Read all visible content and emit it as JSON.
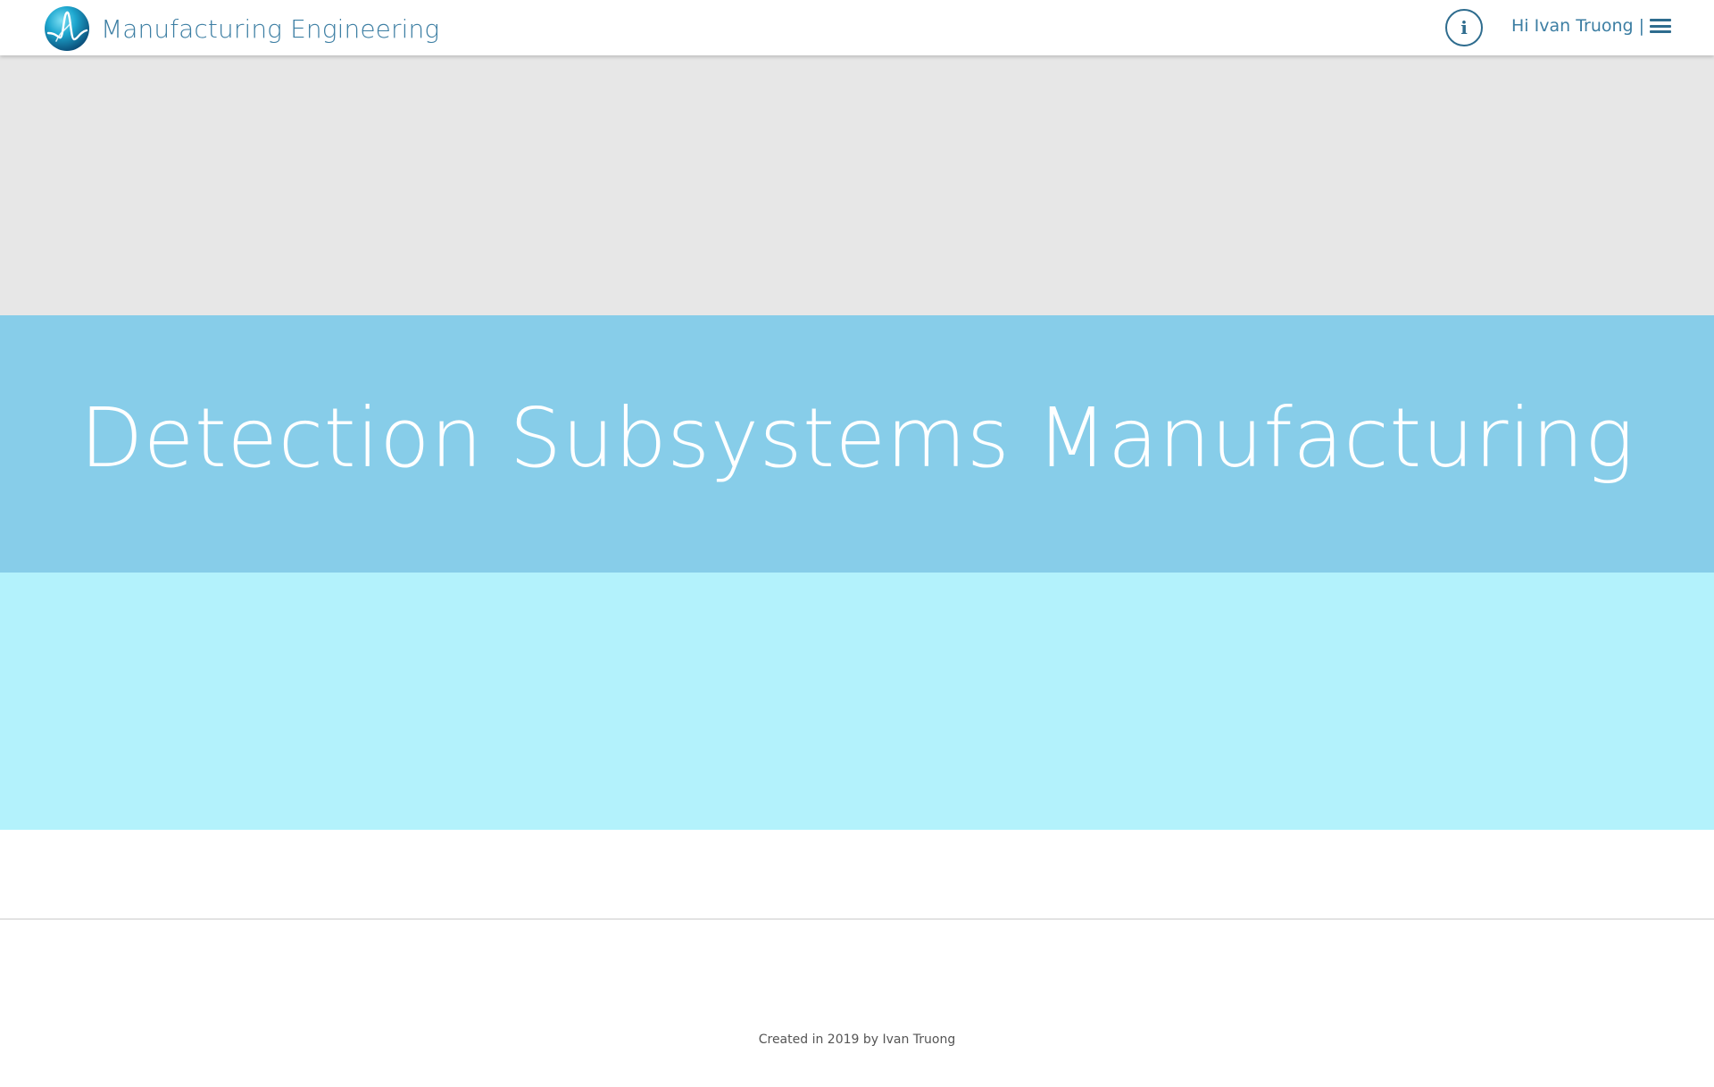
{
  "header": {
    "app_title": "Manufacturing Engineering",
    "logo_icon": "waveform-globe-logo",
    "info_icon_glyph": "i",
    "greeting_prefix": "Hi ",
    "user_name": "Ivan Truong",
    "separator": "|",
    "menu_icon": "hamburger-menu-icon"
  },
  "hero": {
    "title": "Detection Subsystems Manufacturing"
  },
  "footer": {
    "text": "Created in 2019 by Ivan Truong"
  },
  "colors": {
    "brand_text": "#3c7ea3",
    "band_top": "#e7e7e7",
    "band_hero": "#87cde9",
    "band_bottom": "#b3f2fc",
    "icon_dark": "#2e6c8e"
  }
}
